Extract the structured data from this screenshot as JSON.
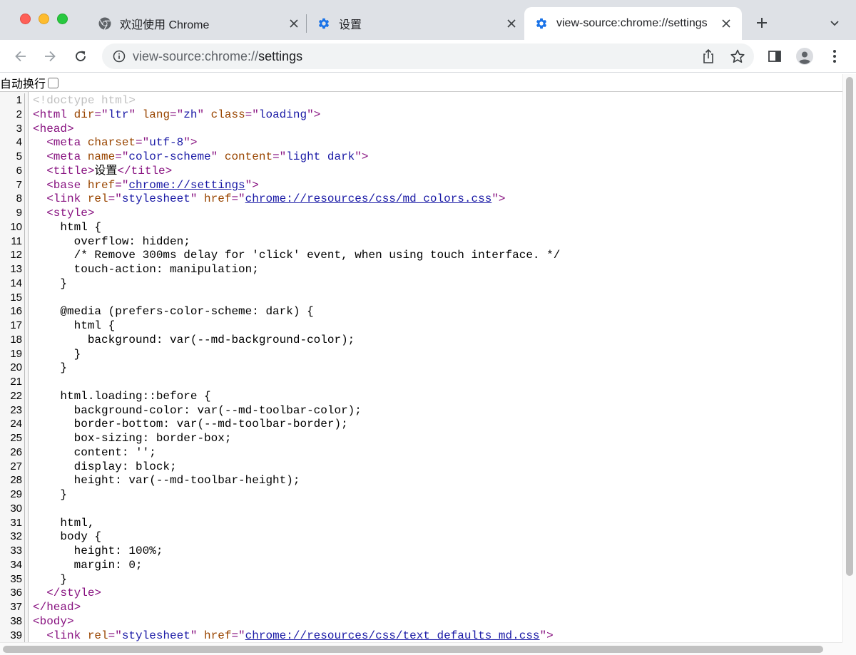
{
  "window": {
    "controls": [
      "close",
      "minimize",
      "zoom"
    ]
  },
  "tabs": [
    {
      "title": "欢迎使用 Chrome",
      "icon": "chrome-icon",
      "active": false
    },
    {
      "title": "设置",
      "icon": "gear-icon",
      "active": false
    },
    {
      "title": "view-source:chrome://settings",
      "icon": "gear-icon",
      "active": true
    }
  ],
  "toolbar": {
    "url_scheme": "view-source:chrome://",
    "url_host": "settings",
    "accent": "#1a73e8"
  },
  "content": {
    "wrap_label": "自动换行",
    "wrap_checked": false
  },
  "lines": [
    {
      "n": "1",
      "parts": [
        [
          "doctype",
          "<!doctype html>"
        ]
      ]
    },
    {
      "n": "2",
      "parts": [
        [
          "tag",
          "<html "
        ],
        [
          "attr",
          "dir"
        ],
        [
          "tag",
          "=\""
        ],
        [
          "val",
          "ltr"
        ],
        [
          "tag",
          "\" "
        ],
        [
          "attr",
          "lang"
        ],
        [
          "tag",
          "=\""
        ],
        [
          "val",
          "zh"
        ],
        [
          "tag",
          "\" "
        ],
        [
          "attr",
          "class"
        ],
        [
          "tag",
          "=\""
        ],
        [
          "val",
          "loading"
        ],
        [
          "tag",
          "\">"
        ]
      ]
    },
    {
      "n": "3",
      "parts": [
        [
          "tag",
          "<head>"
        ]
      ]
    },
    {
      "n": "4",
      "parts": [
        [
          "plain",
          "  "
        ],
        [
          "tag",
          "<meta "
        ],
        [
          "attr",
          "charset"
        ],
        [
          "tag",
          "=\""
        ],
        [
          "val",
          "utf-8"
        ],
        [
          "tag",
          "\">"
        ]
      ]
    },
    {
      "n": "5",
      "parts": [
        [
          "plain",
          "  "
        ],
        [
          "tag",
          "<meta "
        ],
        [
          "attr",
          "name"
        ],
        [
          "tag",
          "=\""
        ],
        [
          "val",
          "color-scheme"
        ],
        [
          "tag",
          "\" "
        ],
        [
          "attr",
          "content"
        ],
        [
          "tag",
          "=\""
        ],
        [
          "val",
          "light dark"
        ],
        [
          "tag",
          "\">"
        ]
      ]
    },
    {
      "n": "6",
      "parts": [
        [
          "plain",
          "  "
        ],
        [
          "tag",
          "<title>"
        ],
        [
          "plain",
          "设置"
        ],
        [
          "tag",
          "</title>"
        ]
      ]
    },
    {
      "n": "7",
      "parts": [
        [
          "plain",
          "  "
        ],
        [
          "tag",
          "<base "
        ],
        [
          "attr",
          "href"
        ],
        [
          "tag",
          "=\""
        ],
        [
          "link",
          "chrome://settings"
        ],
        [
          "tag",
          "\">"
        ]
      ]
    },
    {
      "n": "8",
      "parts": [
        [
          "plain",
          "  "
        ],
        [
          "tag",
          "<link "
        ],
        [
          "attr",
          "rel"
        ],
        [
          "tag",
          "=\""
        ],
        [
          "val",
          "stylesheet"
        ],
        [
          "tag",
          "\" "
        ],
        [
          "attr",
          "href"
        ],
        [
          "tag",
          "=\""
        ],
        [
          "link",
          "chrome://resources/css/md_colors.css"
        ],
        [
          "tag",
          "\">"
        ]
      ]
    },
    {
      "n": "9",
      "parts": [
        [
          "plain",
          "  "
        ],
        [
          "tag",
          "<style>"
        ]
      ]
    },
    {
      "n": "10",
      "parts": [
        [
          "plain",
          "    html {"
        ]
      ]
    },
    {
      "n": "11",
      "parts": [
        [
          "plain",
          "      overflow: hidden;"
        ]
      ]
    },
    {
      "n": "12",
      "parts": [
        [
          "plain",
          "      /* Remove 300ms delay for 'click' event, when using touch interface. */"
        ]
      ]
    },
    {
      "n": "13",
      "parts": [
        [
          "plain",
          "      touch-action: manipulation;"
        ]
      ]
    },
    {
      "n": "14",
      "parts": [
        [
          "plain",
          "    }"
        ]
      ]
    },
    {
      "n": "15",
      "parts": [
        [
          "plain",
          ""
        ]
      ]
    },
    {
      "n": "16",
      "parts": [
        [
          "plain",
          "    @media (prefers-color-scheme: dark) {"
        ]
      ]
    },
    {
      "n": "17",
      "parts": [
        [
          "plain",
          "      html {"
        ]
      ]
    },
    {
      "n": "18",
      "parts": [
        [
          "plain",
          "        background: var(--md-background-color);"
        ]
      ]
    },
    {
      "n": "19",
      "parts": [
        [
          "plain",
          "      }"
        ]
      ]
    },
    {
      "n": "20",
      "parts": [
        [
          "plain",
          "    }"
        ]
      ]
    },
    {
      "n": "21",
      "parts": [
        [
          "plain",
          ""
        ]
      ]
    },
    {
      "n": "22",
      "parts": [
        [
          "plain",
          "    html.loading::before {"
        ]
      ]
    },
    {
      "n": "23",
      "parts": [
        [
          "plain",
          "      background-color: var(--md-toolbar-color);"
        ]
      ]
    },
    {
      "n": "24",
      "parts": [
        [
          "plain",
          "      border-bottom: var(--md-toolbar-border);"
        ]
      ]
    },
    {
      "n": "25",
      "parts": [
        [
          "plain",
          "      box-sizing: border-box;"
        ]
      ]
    },
    {
      "n": "26",
      "parts": [
        [
          "plain",
          "      content: '';"
        ]
      ]
    },
    {
      "n": "27",
      "parts": [
        [
          "plain",
          "      display: block;"
        ]
      ]
    },
    {
      "n": "28",
      "parts": [
        [
          "plain",
          "      height: var(--md-toolbar-height);"
        ]
      ]
    },
    {
      "n": "29",
      "parts": [
        [
          "plain",
          "    }"
        ]
      ]
    },
    {
      "n": "30",
      "parts": [
        [
          "plain",
          ""
        ]
      ]
    },
    {
      "n": "31",
      "parts": [
        [
          "plain",
          "    html,"
        ]
      ]
    },
    {
      "n": "32",
      "parts": [
        [
          "plain",
          "    body {"
        ]
      ]
    },
    {
      "n": "33",
      "parts": [
        [
          "plain",
          "      height: 100%;"
        ]
      ]
    },
    {
      "n": "34",
      "parts": [
        [
          "plain",
          "      margin: 0;"
        ]
      ]
    },
    {
      "n": "35",
      "parts": [
        [
          "plain",
          "    }"
        ]
      ]
    },
    {
      "n": "36",
      "parts": [
        [
          "plain",
          "  "
        ],
        [
          "tag",
          "</style>"
        ]
      ]
    },
    {
      "n": "37",
      "parts": [
        [
          "tag",
          "</head>"
        ]
      ]
    },
    {
      "n": "38",
      "parts": [
        [
          "tag",
          "<body>"
        ]
      ]
    },
    {
      "n": "39",
      "parts": [
        [
          "plain",
          "  "
        ],
        [
          "tag",
          "<link "
        ],
        [
          "attr",
          "rel"
        ],
        [
          "tag",
          "=\""
        ],
        [
          "val",
          "stylesheet"
        ],
        [
          "tag",
          "\" "
        ],
        [
          "attr",
          "href"
        ],
        [
          "tag",
          "=\""
        ],
        [
          "link",
          "chrome://resources/css/text_defaults_md.css"
        ],
        [
          "tag",
          "\">"
        ]
      ]
    }
  ]
}
